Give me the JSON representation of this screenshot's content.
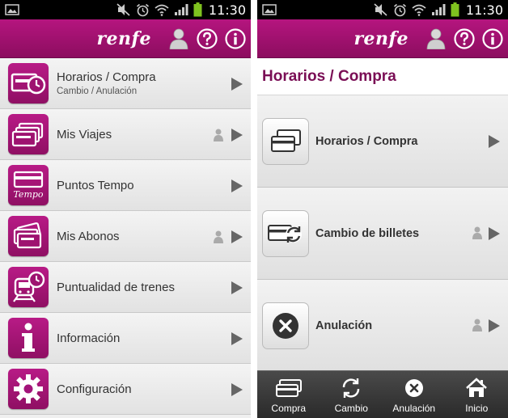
{
  "status_bar": {
    "time": "11:30"
  },
  "brand": {
    "logo_text": "renfe",
    "accent": "#a3147a",
    "heading_color": "#7a0e55"
  },
  "left_screen": {
    "menu_items": [
      {
        "label": "Horarios / Compra",
        "sublabel": "Cambio / Anulación",
        "icon": "ticket-clock-icon",
        "locked": false
      },
      {
        "label": "Mis Viajes",
        "icon": "tickets-stack-icon",
        "locked": true
      },
      {
        "label": "Puntos Tempo",
        "icon": "tempo-card-icon",
        "icon_text": "Tempo",
        "locked": false
      },
      {
        "label": "Mis Abonos",
        "icon": "passes-stack-icon",
        "locked": true
      },
      {
        "label": "Puntualidad de trenes",
        "icon": "train-clock-icon",
        "locked": false
      },
      {
        "label": "Información",
        "icon": "info-icon",
        "locked": false
      },
      {
        "label": "Configuración",
        "icon": "gear-icon",
        "locked": false
      }
    ]
  },
  "right_screen": {
    "heading": "Horarios / Compra",
    "options": [
      {
        "label": "Horarios / Compra",
        "icon": "cards-icon",
        "locked": false
      },
      {
        "label": "Cambio de billetes",
        "icon": "card-exchange-icon",
        "locked": true
      },
      {
        "label": "Anulación",
        "icon": "cancel-icon",
        "locked": true
      }
    ],
    "bottom_nav": [
      {
        "label": "Compra",
        "icon": "ticket-icon"
      },
      {
        "label": "Cambio",
        "icon": "exchange-icon"
      },
      {
        "label": "Anulación",
        "icon": "cancel-icon"
      },
      {
        "label": "Inicio",
        "icon": "home-icon"
      }
    ]
  }
}
